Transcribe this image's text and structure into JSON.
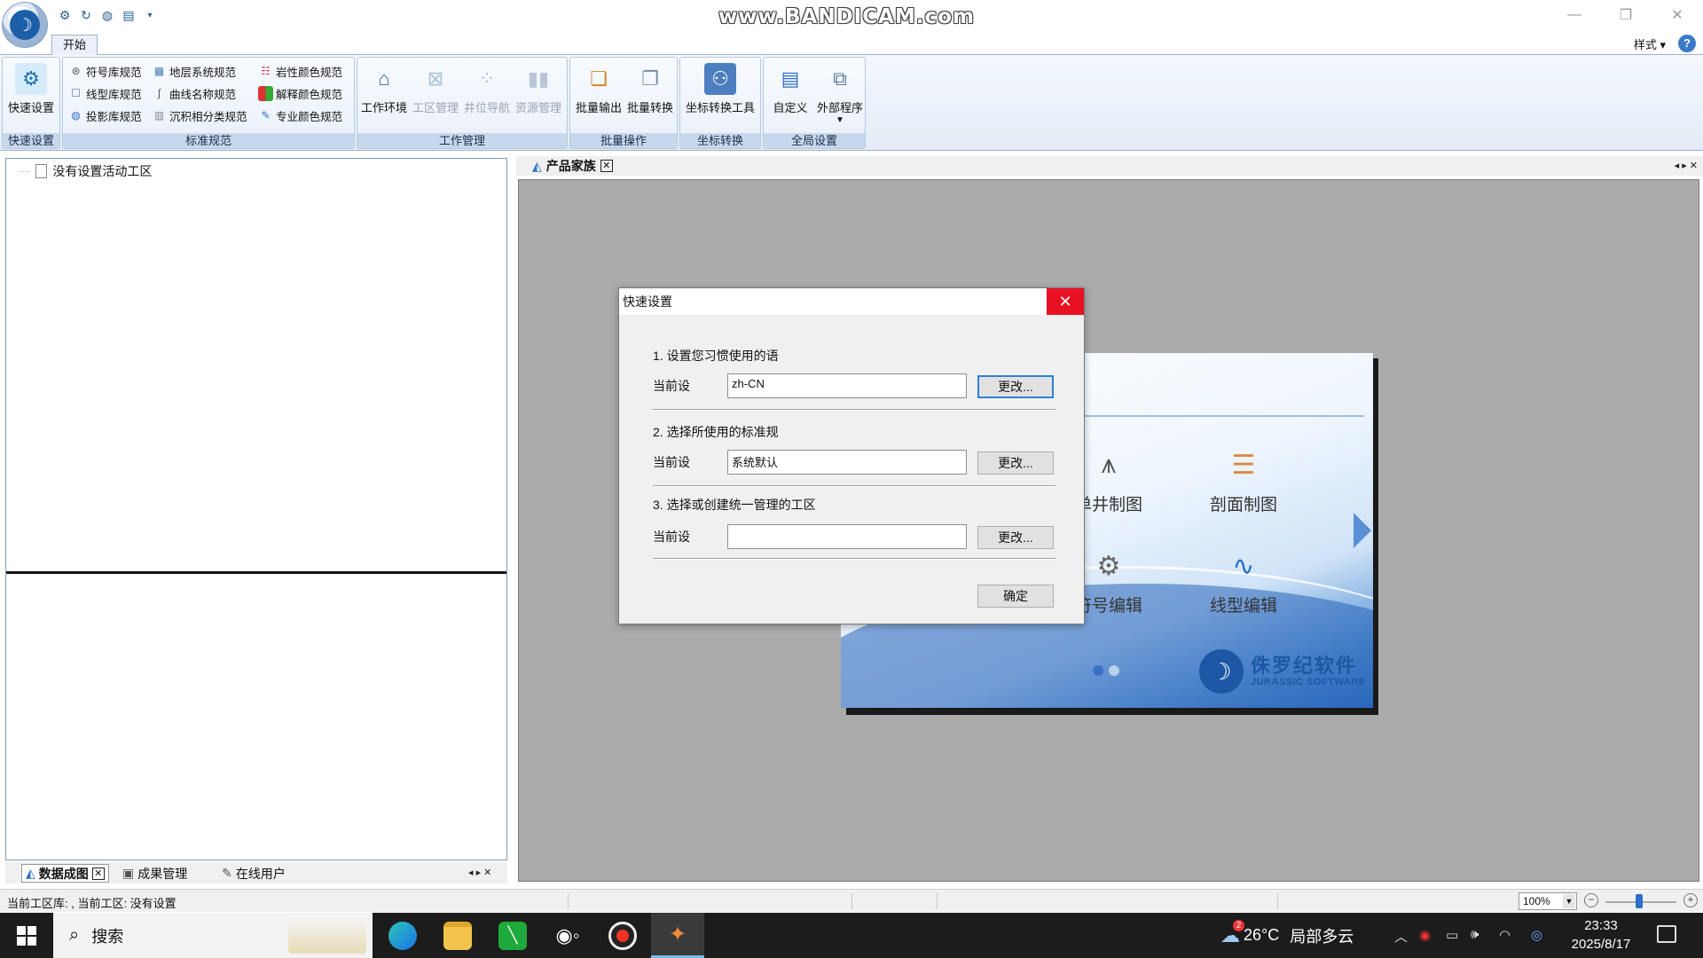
{
  "watermark": "www.BANDICAM.com",
  "titlebar": {
    "qat_icons": [
      "gear-icon",
      "refresh-icon",
      "globe-icon",
      "table-icon",
      "dropdown-icon"
    ],
    "controls": {
      "minimize": "—",
      "restore": "❐",
      "close": "✕"
    }
  },
  "ribbon_tabs": {
    "start": "开始",
    "style_menu": "样式",
    "style_caret": "▾",
    "help": "?"
  },
  "ribbon": {
    "quick_setup": {
      "button": "快速设置",
      "group_label": "快速设置"
    },
    "standards": {
      "group_label": "标准规范",
      "items": [
        "符号库规范",
        "地层系统规范",
        "岩性颜色规范",
        "线型库规范",
        "曲线名称规范",
        "解释颜色规范",
        "投影库规范",
        "沉积相分类规范",
        "专业颜色规范"
      ]
    },
    "work": {
      "group_label": "工作管理",
      "buttons": [
        "工作环境",
        "工区管理",
        "井位导航",
        "资源管理"
      ]
    },
    "batch": {
      "group_label": "批量操作",
      "buttons": [
        "批量输出",
        "批量转换"
      ]
    },
    "coord": {
      "group_label": "坐标转换",
      "buttons": [
        "坐标转换工具"
      ]
    },
    "global": {
      "group_label": "全局设置",
      "buttons": [
        "自定义",
        "外部程序"
      ]
    }
  },
  "left_panel": {
    "tree_item": "没有设置活动工区",
    "tabs": [
      "数据成图",
      "成果管理",
      "在线用户"
    ],
    "tab_close": "✕"
  },
  "doc_tabs": {
    "active": "产品家族",
    "close": "✕",
    "nav": "◂ ▸ ✕"
  },
  "splash": {
    "tiles": [
      "单井制图",
      "剖面制图",
      "符号编辑",
      "线型编辑"
    ],
    "brand_cn": "侏罗纪软件",
    "brand_en": "JURASSIC SOFTWARE"
  },
  "dialog": {
    "title": "快速设置",
    "close": "✕",
    "section1": "1. 设置您习惯使用的语",
    "section2": "2. 选择所使用的标准规",
    "section3": "3. 选择或创建统一管理的工区",
    "current_label": "当前设",
    "value1": "zh-CN",
    "value2": "系统默认",
    "value3": "",
    "change_button": "更改...",
    "ok_button": "确定"
  },
  "statusbar": {
    "text": "当前工区库: , 当前工区: 没有设置",
    "zoom": "100%",
    "zoom_level": 0.45
  },
  "taskbar": {
    "search_placeholder": "搜索",
    "apps": [
      "edge-icon",
      "file-explorer-icon",
      "green-app-icon",
      "wechat-icon",
      "bandicam-record-icon",
      "jurassic-app-icon"
    ],
    "weather_temp": "26°C",
    "weather_text": "局部多云",
    "weather_badge": "2",
    "time": "23:33",
    "date": "2025/8/17"
  }
}
